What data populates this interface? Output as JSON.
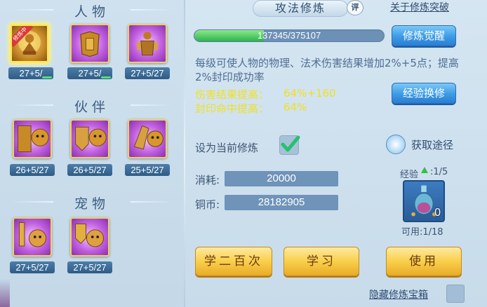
{
  "left": {
    "sections": {
      "character": "人物",
      "partner": "伙伴",
      "pet": "宠物"
    },
    "character_slots": [
      {
        "icon": "cultivating-figure-icon",
        "ribbon": "修炼中",
        "level": "27+5/",
        "level_bar": 0.8
      },
      {
        "icon": "armor-icon",
        "level": "27+5/",
        "level_bar": 0.8
      },
      {
        "icon": "warrior-figure-icon",
        "level": "27+5/27"
      }
    ],
    "partner_slots": [
      {
        "icon": "sword-lion-icon",
        "level": "26+5/27"
      },
      {
        "icon": "shield-lion-icon",
        "level": "26+5/27"
      },
      {
        "icon": "gauntlet-lion-icon",
        "level": "25+5/27"
      }
    ],
    "pet_slots": [
      {
        "icon": "sword-cat-icon",
        "level": "27+5/27"
      },
      {
        "icon": "shield-cat-icon",
        "level": "27+5/27"
      }
    ]
  },
  "right": {
    "tab_title": "攻法修炼",
    "badge": "评",
    "about_link": "关于修炼突破",
    "progress": {
      "text": "137345/375107",
      "current": 137345,
      "max": 375107
    },
    "awaken_button": "修炼觉醒",
    "description": "每级可使人物的物理、法术伤害结果增加2%+5点；提高2%封印成功率",
    "stats": [
      {
        "label": "伤害结果提高：",
        "value": "64%+160"
      },
      {
        "label": "封印命中提高：",
        "value": "64%"
      }
    ],
    "exchange_button": "经验换修",
    "set_current_label": "设为当前修炼",
    "set_current_checked": true,
    "get_path_label": "获取途径",
    "cost_label": "消耗:",
    "cost_value": "20000",
    "copper_label": "铜币:",
    "copper_value": "28182905",
    "exp_label": "经验",
    "exp_value": ":1/5",
    "item_count": "0",
    "usable_label": "可用:1/18",
    "btn_learn100": "学二百次",
    "btn_learn": "学习",
    "btn_use": "使用",
    "hidden_box_label": "隐藏修炼宝箱"
  }
}
